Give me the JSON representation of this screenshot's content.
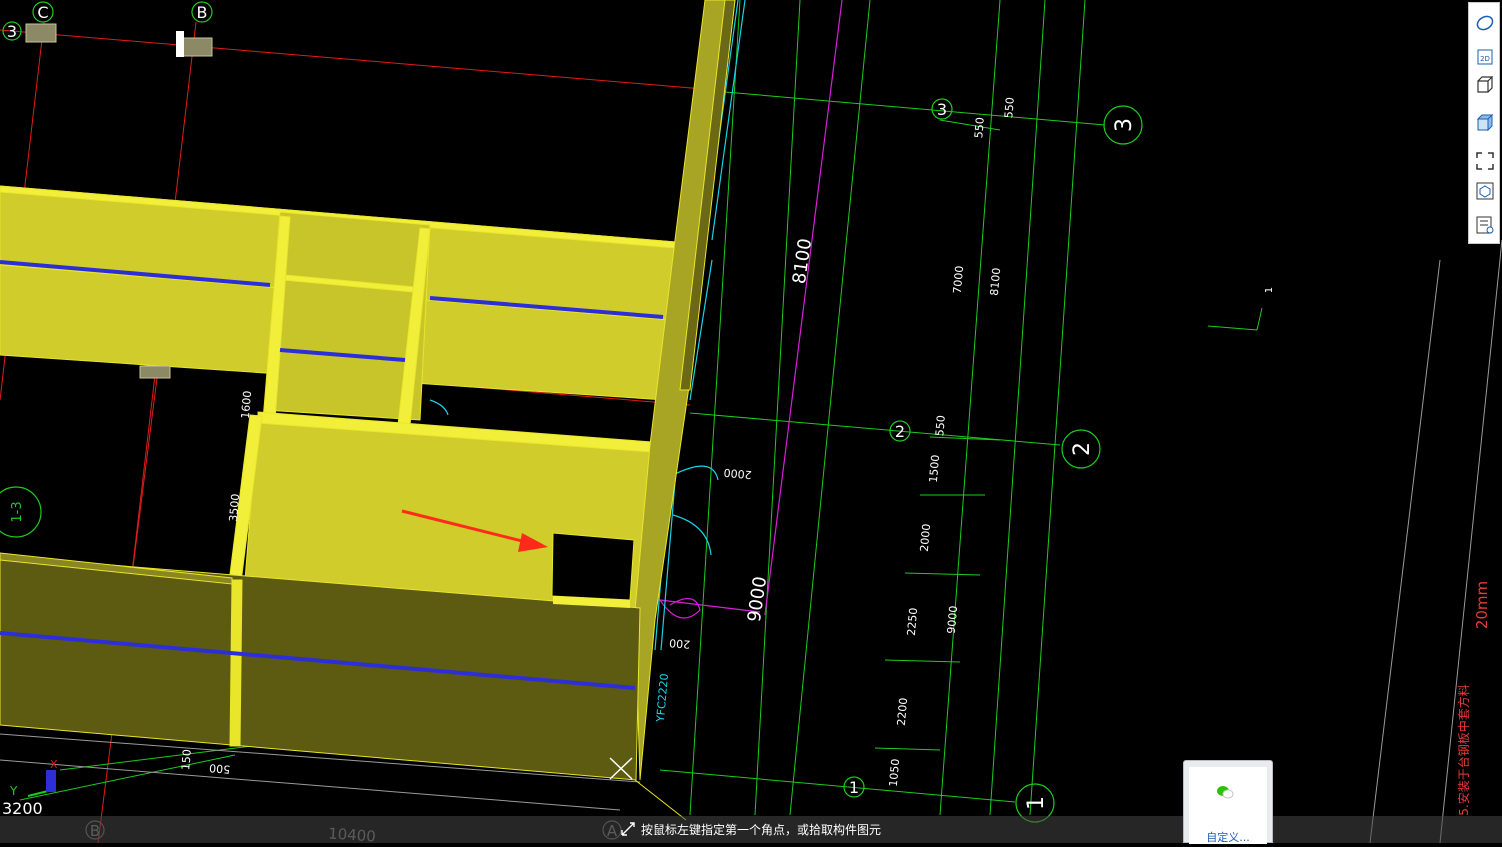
{
  "canvas": {
    "grid_bubbles": {
      "c_top": "C",
      "b_top": "B",
      "three_left": "3",
      "three_mid": "3",
      "three_right": "3",
      "two_mid": "2",
      "two_right": "2",
      "one_mid": "1",
      "one_right": "1",
      "section_left": "1-3",
      "b_bottom": "B",
      "a_bottom": "A"
    },
    "dimensions": {
      "d8100_big": "8100",
      "d9000_big": "9000",
      "d550_a": "550",
      "d550_b": "550",
      "d550_c": "550",
      "d7000": "7000",
      "d8100_small": "8100",
      "d1500": "1500",
      "d2000_v": "2000",
      "d9000_small": "9000",
      "d2250": "2250",
      "d2200": "2200",
      "d1050": "1050",
      "d2000_h": "2000",
      "d200": "200",
      "d1600": "1600",
      "d3500": "3500",
      "d150": "150",
      "d500": "500",
      "d10400": "10400",
      "d3200": "3200"
    },
    "annotations": {
      "door_tag": "YFC2220",
      "scale_text": "20mm",
      "note_text": "5.安装于台钢板中套方料",
      "section_mark": "1"
    },
    "ucs": {
      "x_label": "X",
      "y_label": "Y"
    }
  },
  "toolbar": {
    "buttons": [
      {
        "name": "orbit-button",
        "icon": "orbit-icon"
      },
      {
        "name": "view-2d-button",
        "icon": "view-2d-icon",
        "label": "2D"
      },
      {
        "name": "view-3d-wire-button",
        "icon": "box-wire-icon"
      },
      {
        "name": "view-3d-solid-button",
        "icon": "box-solid-icon"
      },
      {
        "name": "fullscreen-button",
        "icon": "fullscreen-icon"
      },
      {
        "name": "component-view-button",
        "icon": "cube-view-icon"
      },
      {
        "name": "properties-button",
        "icon": "list-settings-icon"
      }
    ]
  },
  "status_bar": {
    "prompt": "按鼠标左键指定第一个角点，或拾取构件图元"
  },
  "float_panel": {
    "label": "自定义..."
  },
  "colors": {
    "wall_top": "#f2ef3a",
    "wall_face": "#cfcc2b",
    "wall_dark": "#5d5a12",
    "beam_line": "#2c2fd8",
    "grid_green": "#1ecb1e",
    "axis_red": "#e11b1b",
    "magenta": "#d81ed8",
    "cyan": "#19d2e6",
    "arrow": "#ff2a1a"
  }
}
